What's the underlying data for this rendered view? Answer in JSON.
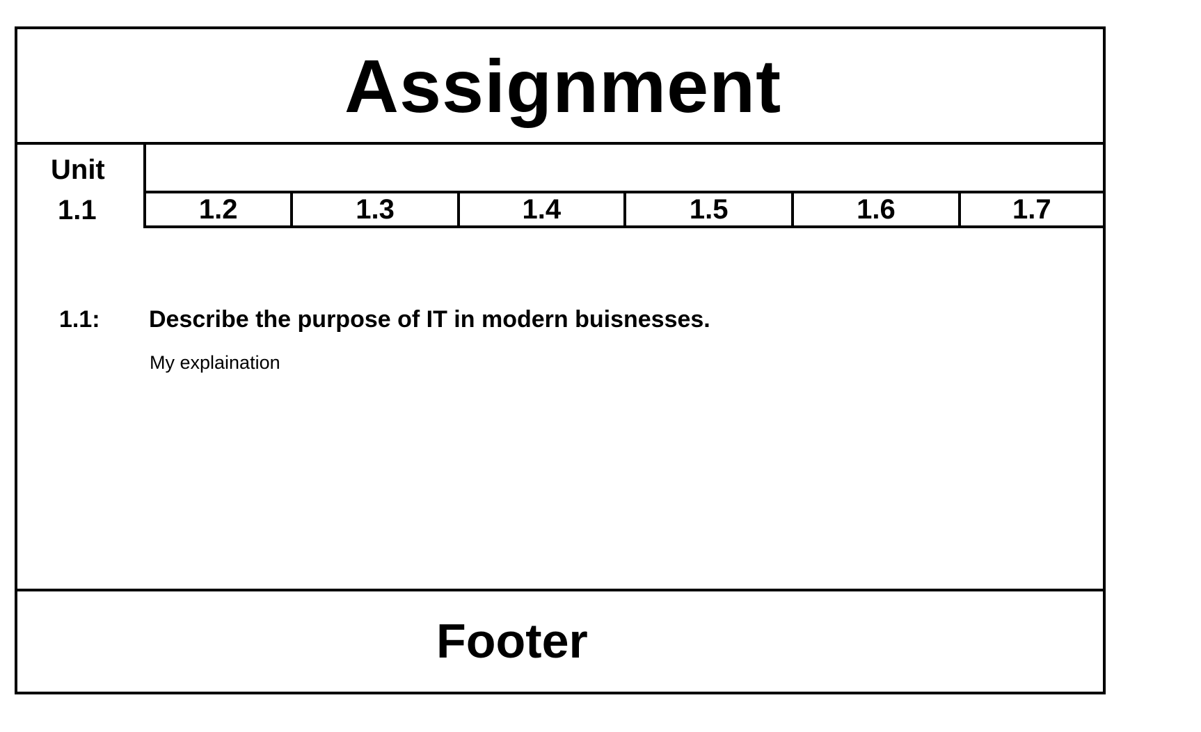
{
  "header": {
    "title": "Assignment"
  },
  "unit": {
    "label": "Unit",
    "tabs": [
      "1.1",
      "1.2",
      "1.3",
      "1.4",
      "1.5",
      "1.6",
      "1.7"
    ]
  },
  "question": {
    "number": "1.1:",
    "text": "Describe the purpose of IT in modern buisnesses.",
    "answer": "My explaination"
  },
  "footer": {
    "title": "Footer"
  }
}
